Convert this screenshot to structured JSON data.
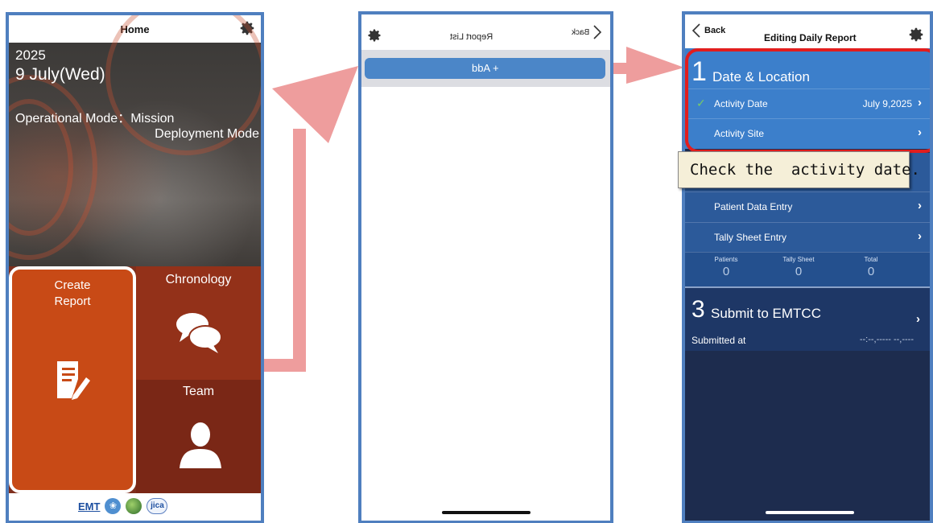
{
  "home": {
    "title": "Home",
    "year": "2025",
    "date": "9 July(Wed)",
    "mode_line1": "Operational Mode：Mission",
    "mode_line2": "Deployment Mode",
    "tiles": {
      "create_report": "Create\nReport",
      "chronology": "Chronology",
      "team": "Team"
    },
    "footer_logo_text": "EMT",
    "footer_jica": "jica"
  },
  "report_list": {
    "title": "Report List",
    "back_label": "Back",
    "add_label": "+ Add"
  },
  "edit_report": {
    "back_label": "Back",
    "title": "Editing Daily Report",
    "section1": {
      "number": "1",
      "heading": "Date & Location"
    },
    "rows": {
      "activity_date": {
        "label": "Activity Date",
        "value": "July 9,2025"
      },
      "activity_site": {
        "label": "Activity Site"
      },
      "patient_data": {
        "label": "Patient Data Entry"
      },
      "tally_sheet": {
        "label": "Tally Sheet Entry"
      }
    },
    "stats": [
      {
        "label": "Patients",
        "value": "0"
      },
      {
        "label": "Tally Sheet",
        "value": "0"
      },
      {
        "label": "Total",
        "value": "0"
      }
    ],
    "section3": {
      "number": "3",
      "heading": "Submit to EMTCC",
      "submitted_label": "Submitted at",
      "submitted_value": "--:--,----- --,----"
    }
  },
  "tooltip": "Check the  activity date.",
  "colors": {
    "frame_border": "#4f7fbf",
    "create_tile": "#c84a16",
    "section1_blue": "#3c7fcb",
    "highlight_red": "#e21d1d",
    "arrow_pink": "#ee9d9d"
  }
}
